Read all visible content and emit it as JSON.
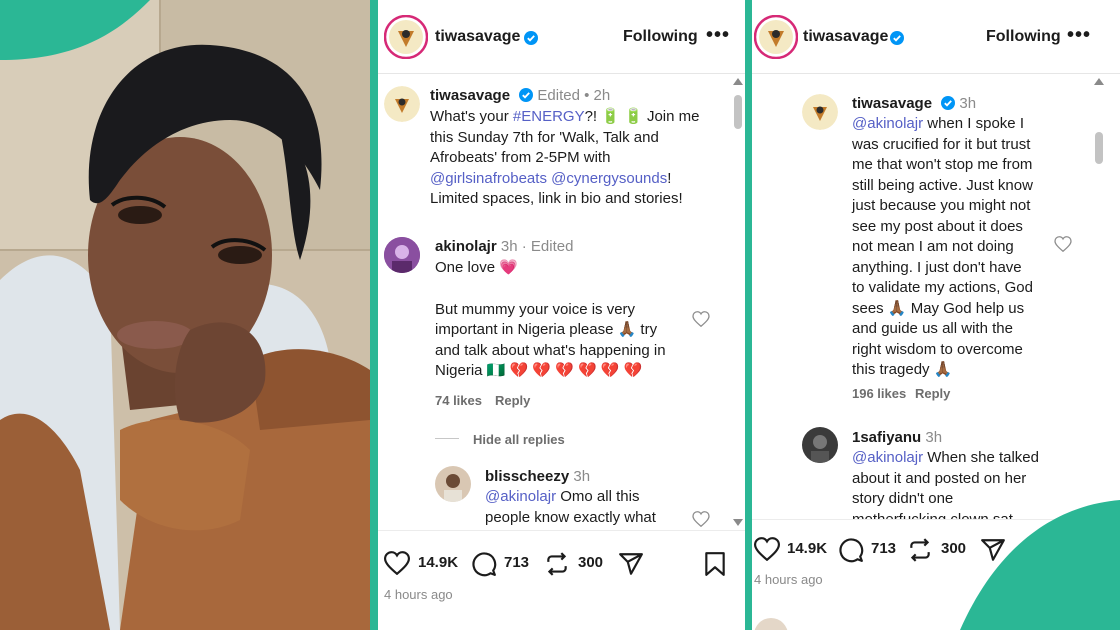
{
  "left_post": {
    "username": "tiwasavage",
    "follow_label": "Following",
    "more_label": "•••",
    "caption": {
      "username": "tiwasavage",
      "edited": "Edited •",
      "time": "2h",
      "line1_pre": "What's your ",
      "hashtag": "#ENERGY",
      "line1_post": "?! 🔋 🔋 Join me",
      "line2": "this Sunday 7th for 'Walk, Talk and",
      "line3": "Afrobeats' from 2-5PM with",
      "mention1": "@girlsinafrobeats",
      "mention2": "@cynergysounds",
      "line4_end": "!",
      "line5": "Limited spaces, link in bio and stories!"
    },
    "comment1": {
      "username": "akinolajr",
      "meta": "3h · Edited",
      "line1": "One love 💗",
      "line2": "But mummy your voice is very",
      "line3": "important in Nigeria please 🙏🏾 try",
      "line4": "and talk about what's happening in",
      "line5": "Nigeria 🇳🇬 💔 💔 💔 💔 💔 💔",
      "likes": "74 likes",
      "reply": "Reply"
    },
    "hide_replies": "Hide all replies",
    "comment2": {
      "username": "blisscheezy",
      "meta": "3h",
      "mention": "@akinolajr",
      "line1_rest": " Omo all this",
      "line2": "people know exactly what"
    },
    "likes_count": "14.9K",
    "comments_count": "713",
    "reposts_count": "300",
    "time_ago": "4 hours ago"
  },
  "right_post": {
    "username": "tiwasavage",
    "follow_label": "Following",
    "more_label": "•••",
    "comment1": {
      "username": "tiwasavage",
      "meta": "3h",
      "mention": "@akinolajr",
      "line1_rest": " when I spoke I",
      "line2": "was crucified for it but trust",
      "line3": "me that won't stop me from",
      "line4": "still being active. Just know",
      "line5": "just because you might not",
      "line6": "see my post about it does",
      "line7": "not mean I am not doing",
      "line8": "anything. I just don't have",
      "line9": "to validate my actions, God",
      "line10": "sees 🙏🏾 May God help us",
      "line11": "and guide us all with the",
      "line12": "right wisdom to overcome",
      "line13": "this tragedy 🙏🏾",
      "likes": "196 likes",
      "reply": "Reply"
    },
    "comment2": {
      "username": "1safiyanu",
      "meta": "3h",
      "mention": "@akinolajr",
      "line1_rest": " When she talked",
      "line2": "about it and posted on her",
      "line3": "story didn't one",
      "line4": "motherfucking clown sat"
    },
    "likes_count": "14.9K",
    "comments_count": "713",
    "reposts_count": "300",
    "time_ago": "4 hours ago"
  },
  "colors": {
    "accent_green": "#2bb795",
    "link": "#5660c6",
    "verified": "#0095f6"
  }
}
